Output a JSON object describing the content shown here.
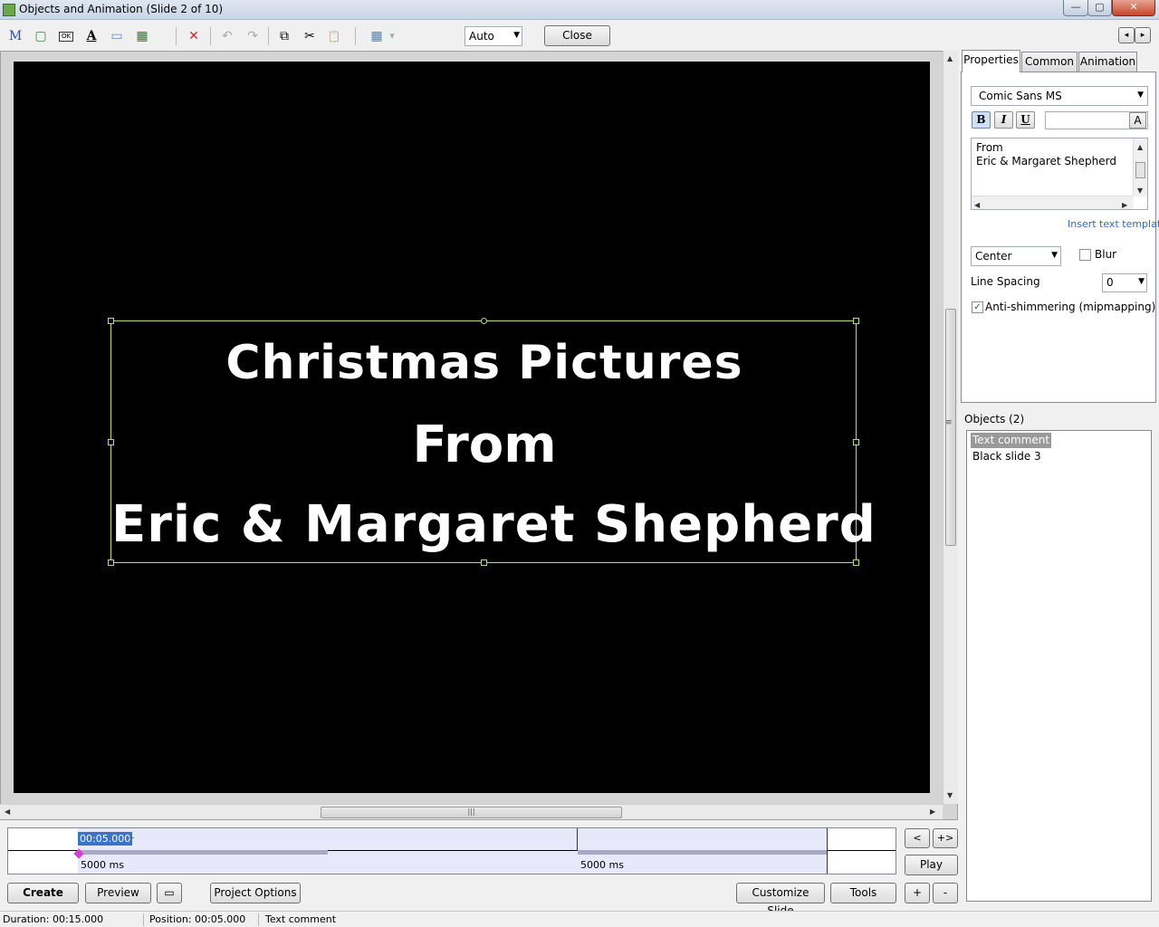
{
  "window": {
    "title": "Objects and Animation  (Slide 2 of 10)",
    "controls": {
      "minimize": "—",
      "maximize": "▢",
      "close": "✕"
    }
  },
  "toolbar": {
    "tools": [
      {
        "name": "m-tool-icon",
        "glyph": "M"
      },
      {
        "name": "rectangle-icon",
        "glyph": "▢"
      },
      {
        "name": "button-icon",
        "glyph": "OK"
      },
      {
        "name": "text-icon",
        "glyph": "A"
      },
      {
        "name": "frame-icon",
        "glyph": "▭"
      },
      {
        "name": "image-icon",
        "glyph": "▦"
      }
    ],
    "delete_glyph": "✕",
    "undo_glyph": "↶",
    "redo_glyph": "↷",
    "copy_glyph": "⧉",
    "cut_glyph": "✂",
    "paste_glyph": "📋",
    "grid_glyph": "▦",
    "grid_dropdown_glyph": "▾",
    "zoom_value": "Auto",
    "close_label": "Close",
    "nav_prev": "◂",
    "nav_next": "▸"
  },
  "slide": {
    "lines": [
      "Christmas Pictures",
      "From",
      "Eric & Margaret Shepherd"
    ]
  },
  "timeline": {
    "current_time": "00:05.000",
    "plus": "+",
    "segment1_label": "5000 ms",
    "segment2_label": "5000 ms",
    "prev_label": "<",
    "fit_label": "+>",
    "play_label": "Play"
  },
  "bottom_buttons": {
    "create": "Create",
    "preview": "Preview",
    "screen": "▭",
    "project_options": "Project Options",
    "customize_slide": "Customize Slide",
    "tools": "Tools",
    "plus": "+",
    "minus": "-"
  },
  "status": {
    "duration": "Duration:  00:15.000",
    "position": "Position:  00:05.000",
    "object": "Text comment"
  },
  "panel": {
    "tabs": [
      "Properties",
      "Common",
      "Animation"
    ],
    "active_tab": "Properties",
    "font": "Comic Sans MS",
    "bold": "B",
    "italic": "I",
    "underline": "U",
    "color_btn": "A",
    "text_value_line1": "From",
    "text_value_line2": "Eric & Margaret Shepherd",
    "insert_template": "Insert text template",
    "alignment": "Center",
    "blur_label": "Blur",
    "blur_checked": false,
    "line_spacing_label": "Line Spacing",
    "line_spacing_value": "0",
    "antishimmer_label": "Anti-shimmering (mipmapping)",
    "antishimmer_checked": true
  },
  "objects": {
    "label": "Objects (2)",
    "items": [
      "Text comment",
      "Black slide 3"
    ],
    "selected": "Text comment"
  },
  "colors": {
    "canvas": "#000000",
    "selection_outline": "#b6e06b",
    "timeline_band": "#e8e8fb",
    "link": "#3366cc"
  }
}
